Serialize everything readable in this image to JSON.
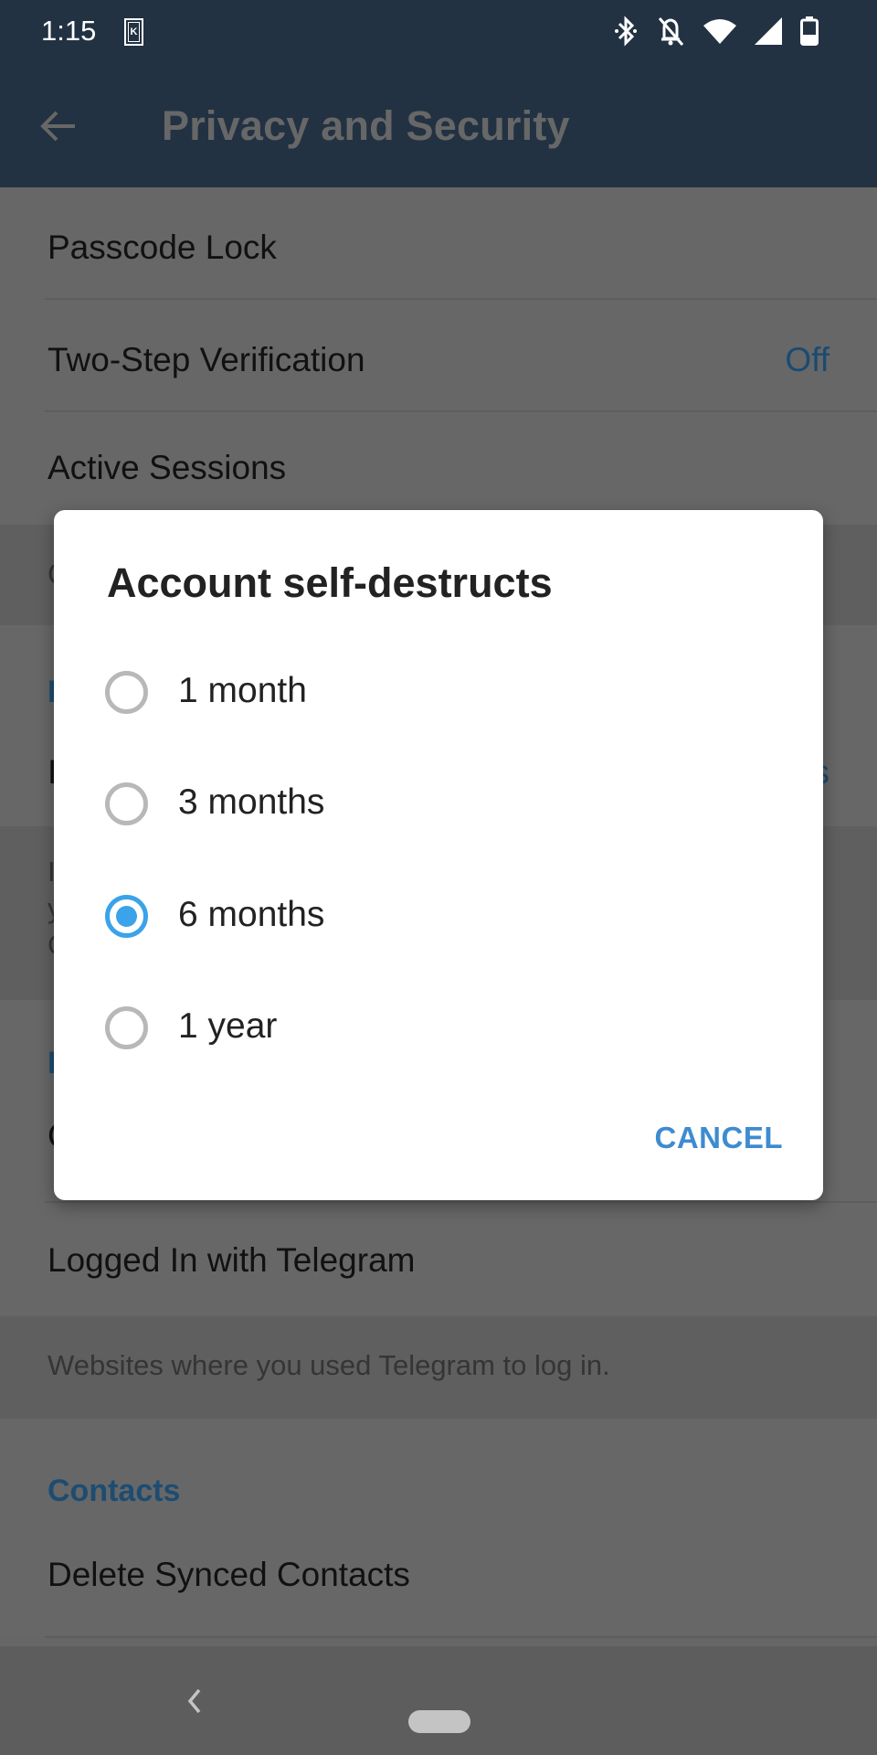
{
  "status_bar": {
    "time": "1:15",
    "notification_icon": "k-app-icon",
    "icons": [
      "bluetooth-icon",
      "notifications-off-icon",
      "wifi-icon",
      "signal-icon",
      "battery-icon"
    ]
  },
  "app_bar": {
    "title": "Privacy and Security",
    "back_icon": "arrow-left-icon"
  },
  "settings_list": {
    "rows": [
      {
        "label": "Passcode Lock",
        "value": ""
      },
      {
        "label": "Two-Step Verification",
        "value": "Off"
      },
      {
        "label": "Active Sessions",
        "value": ""
      }
    ],
    "partially_hidden": {
      "row_initial_1": "C",
      "section_initial_1": "I",
      "row_initial_2": "I",
      "row_value_tail": "s",
      "info_initials": [
        "I",
        "y",
        "C"
      ],
      "section_initial_2": "I",
      "row_initial_3": "C"
    },
    "logged_in_row": {
      "label": "Logged In with Telegram"
    },
    "logged_in_info": "Websites where you used Telegram to log in.",
    "contacts_section": {
      "title": "Contacts"
    },
    "contacts_rows": [
      {
        "label": "Delete Synced Contacts"
      }
    ]
  },
  "dialog": {
    "title": "Account self-destructs",
    "options": [
      {
        "label": "1 month",
        "selected": false
      },
      {
        "label": "3 months",
        "selected": false
      },
      {
        "label": "6 months",
        "selected": true
      },
      {
        "label": "1 year",
        "selected": false
      }
    ],
    "cancel_label": "CANCEL"
  },
  "colors": {
    "app_bar": "#223243",
    "accent": "#3aa3e9",
    "button_text": "#3e8bd0",
    "value_text": "#1a4b72"
  }
}
